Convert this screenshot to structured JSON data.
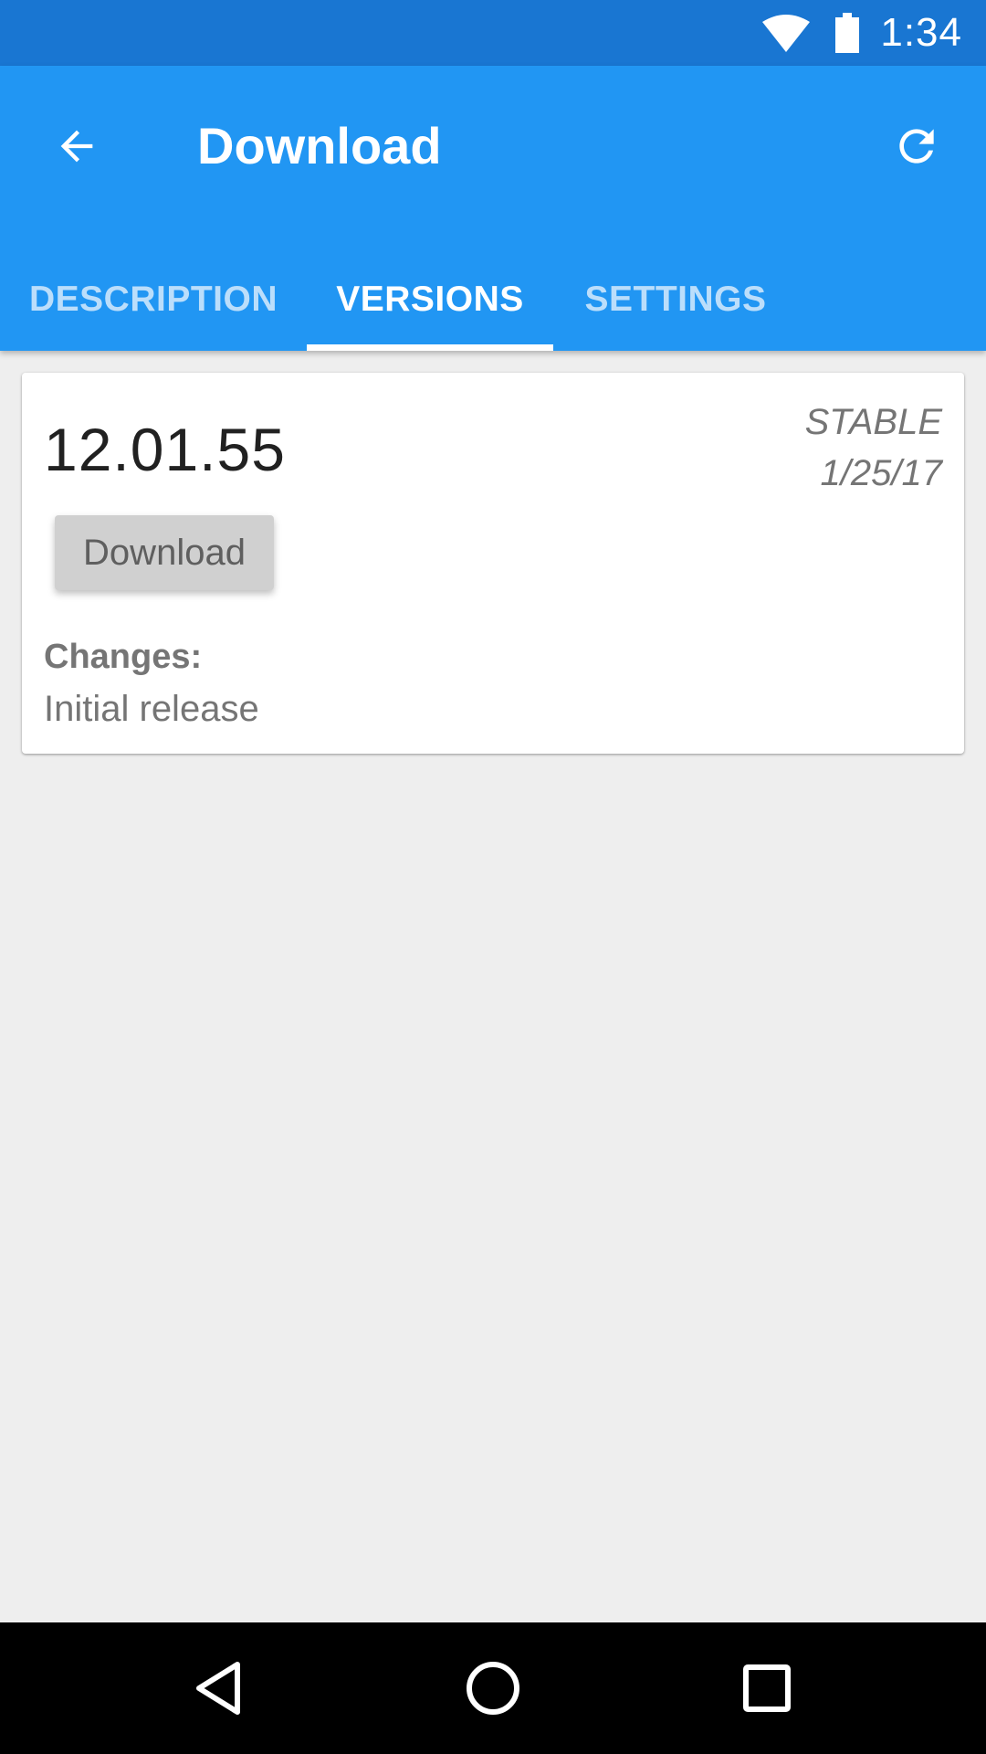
{
  "status_bar": {
    "time": "1:34",
    "icons": [
      "wifi-icon",
      "battery-icon"
    ]
  },
  "app_bar": {
    "title": "Download",
    "back_icon": "arrow-back-icon",
    "refresh_icon": "refresh-icon",
    "background_color": "#2196f3"
  },
  "tabs": [
    {
      "label": "DESCRIPTION",
      "active": false
    },
    {
      "label": "VERSIONS",
      "active": true
    },
    {
      "label": "SETTINGS",
      "active": false
    }
  ],
  "version_card": {
    "version": "12.01.55",
    "channel": "STABLE",
    "date": "1/25/17",
    "download_label": "Download",
    "changes_label": "Changes:",
    "changes_text": "Initial release"
  },
  "nav_bar": {
    "icons": [
      "nav-back-icon",
      "nav-home-icon",
      "nav-recents-icon"
    ]
  }
}
